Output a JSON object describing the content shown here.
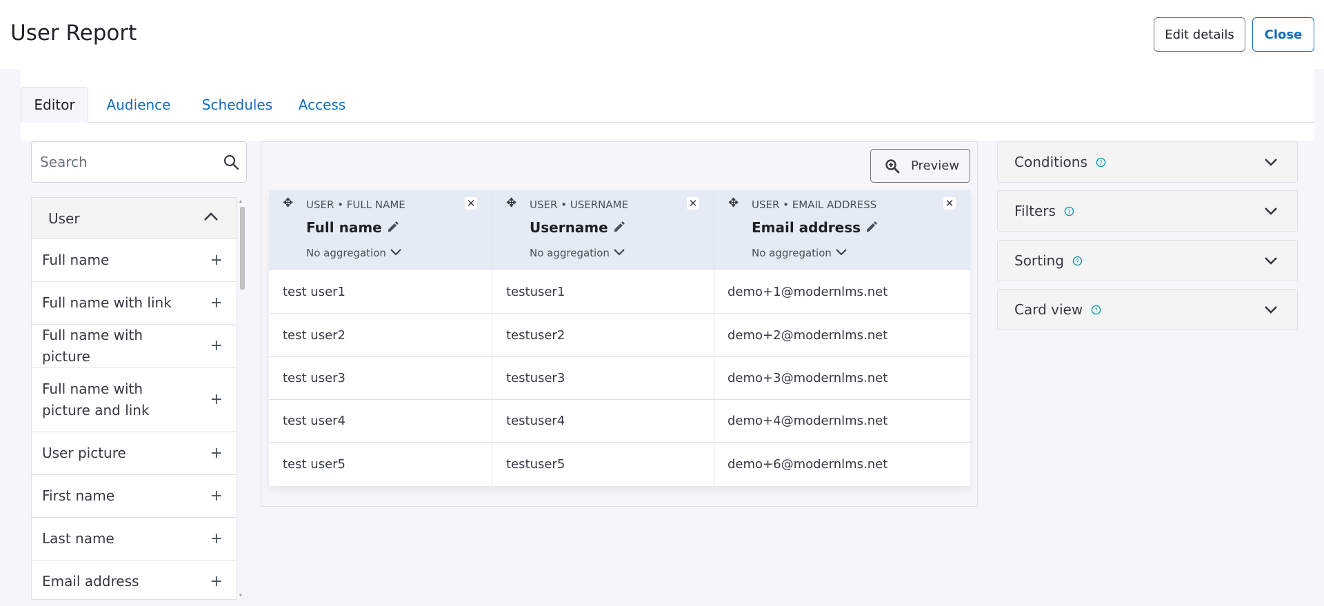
{
  "header": {
    "title": "User Report",
    "edit_label": "Edit details",
    "close_label": "Close"
  },
  "tabs": [
    {
      "label": "Editor",
      "active": true
    },
    {
      "label": "Audience",
      "active": false
    },
    {
      "label": "Schedules",
      "active": false
    },
    {
      "label": "Access",
      "active": false
    }
  ],
  "sidebar": {
    "search_placeholder": "Search",
    "group": "User",
    "items": [
      {
        "label": "Full name"
      },
      {
        "label": "Full name with link"
      },
      {
        "label": "Full name with picture"
      },
      {
        "label": "Full name with picture and link"
      },
      {
        "label": "User picture"
      },
      {
        "label": "First name"
      },
      {
        "label": "Last name"
      },
      {
        "label": "Email address"
      }
    ]
  },
  "editor": {
    "preview_label": "Preview",
    "columns": [
      {
        "entity": "USER • FULL NAME",
        "name": "Full name",
        "aggregation": "No aggregation"
      },
      {
        "entity": "USER • USERNAME",
        "name": "Username",
        "aggregation": "No aggregation"
      },
      {
        "entity": "USER • EMAIL ADDRESS",
        "name": "Email address",
        "aggregation": "No aggregation"
      }
    ],
    "rows": [
      [
        "test user1",
        "testuser1",
        "demo+1@modernlms.net"
      ],
      [
        "test user2",
        "testuser2",
        "demo+2@modernlms.net"
      ],
      [
        "test user3",
        "testuser3",
        "demo+3@modernlms.net"
      ],
      [
        "test user4",
        "testuser4",
        "demo+4@modernlms.net"
      ],
      [
        "test user5",
        "testuser5",
        "demo+6@modernlms.net"
      ]
    ]
  },
  "panels": [
    {
      "label": "Conditions"
    },
    {
      "label": "Filters"
    },
    {
      "label": "Sorting"
    },
    {
      "label": "Card view"
    }
  ],
  "colors": {
    "link": "#0f6cbf",
    "help_icon": "#0f9ba8",
    "column_header_bg": "#e5ebf5"
  }
}
